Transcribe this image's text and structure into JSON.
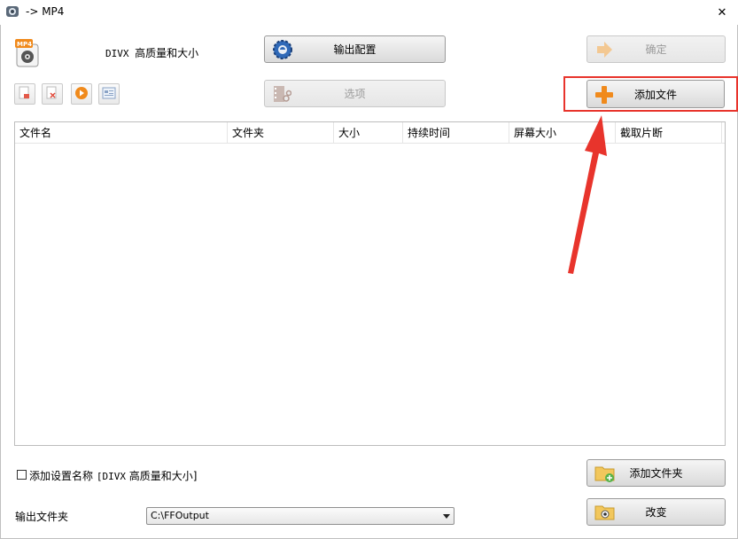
{
  "window": {
    "title": "-> MP4",
    "close_glyph": "✕"
  },
  "profile": {
    "prefix": "DIVX",
    "name": "高质量和大小"
  },
  "buttons": {
    "output_config": "输出配置",
    "confirm": "确定",
    "options": "选项",
    "add_file": "添加文件",
    "add_folder": "添加文件夹",
    "change": "改变"
  },
  "toolbar_icons": [
    "clear-list-icon",
    "remove-item-icon",
    "play-icon",
    "media-info-icon"
  ],
  "file_list": {
    "columns": [
      "文件名",
      "文件夹",
      "大小",
      "持续时间",
      "屏幕大小",
      "截取片断"
    ]
  },
  "add_name_option": {
    "label": "添加设置名称",
    "value_mono": "[DIVX",
    "value_cn": "高质量和大小]",
    "checked": false
  },
  "output_folder": {
    "label": "输出文件夹",
    "value": "C:\\FFOutput"
  },
  "colors": {
    "highlight": "#e8342c",
    "accent_orange": "#f08a1c"
  }
}
